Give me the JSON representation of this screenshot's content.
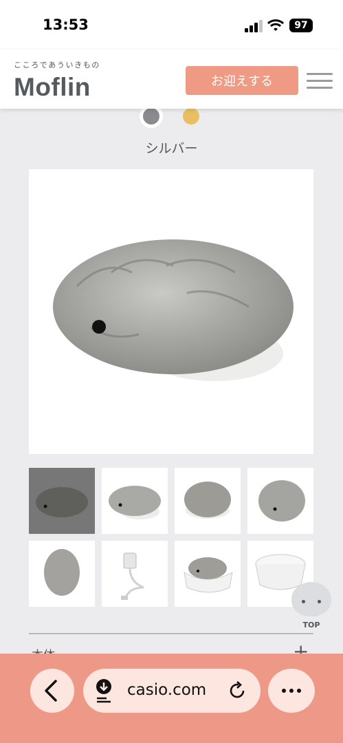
{
  "status": {
    "time": "13:53",
    "battery": "97"
  },
  "header": {
    "tagline": "こころであういきもの",
    "logo": "Moflin",
    "cta_label": "お迎えする"
  },
  "product": {
    "color_name": "シルバー",
    "swatches": [
      {
        "name": "silver",
        "color": "#8a8a8f",
        "selected": true
      },
      {
        "name": "gold",
        "color": "#e8c063",
        "selected": false
      }
    ],
    "thumbnail_count": 8
  },
  "accordion": {
    "label": "本体",
    "icon": "plus-icon"
  },
  "top_button": {
    "label": "TOP"
  },
  "browser": {
    "url": "casio.com"
  },
  "colors": {
    "accent": "#ef9a85",
    "browser_bar": "#ee9987",
    "pill": "#fde6df"
  }
}
